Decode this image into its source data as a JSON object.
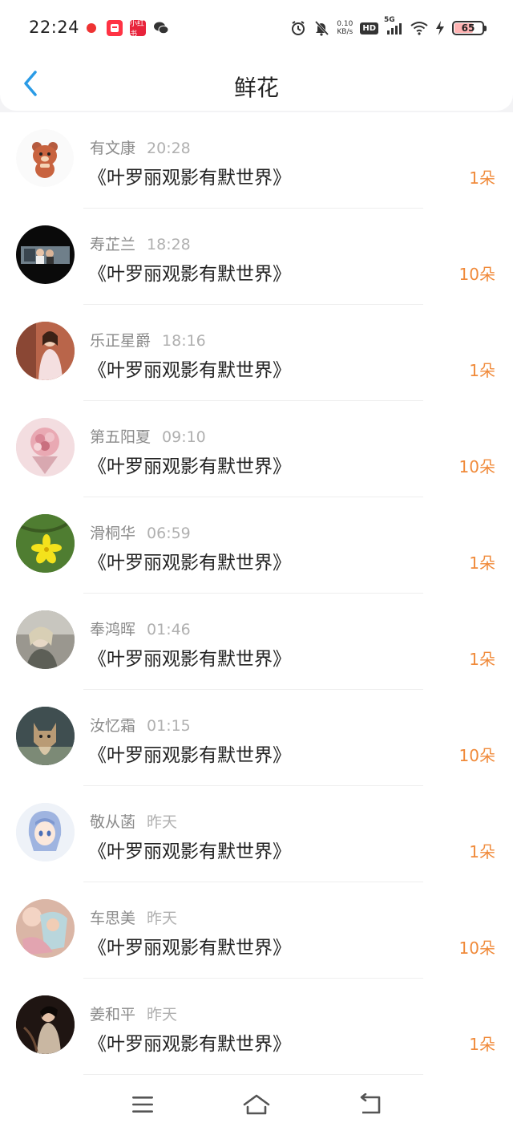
{
  "status_bar": {
    "time": "22:24",
    "net_speed_value": "0.10",
    "net_speed_unit": "KB/s",
    "hd_label": "HD",
    "signal_label": "5G",
    "battery_level": "65",
    "app_icon_labels": [
      "",
      "",
      "小红书",
      ""
    ]
  },
  "header": {
    "title": "鲜花"
  },
  "colors": {
    "amount": "#f08a3a",
    "back_arrow": "#2a9be6"
  },
  "rows": [
    {
      "name": "有文康",
      "time": "20:28",
      "title": "《叶罗丽观影有默世界》",
      "amount": "1朵"
    },
    {
      "name": "寿芷兰",
      "time": "18:28",
      "title": "《叶罗丽观影有默世界》",
      "amount": "10朵"
    },
    {
      "name": "乐正星爵",
      "time": "18:16",
      "title": "《叶罗丽观影有默世界》",
      "amount": "1朵"
    },
    {
      "name": "第五阳夏",
      "time": "09:10",
      "title": "《叶罗丽观影有默世界》",
      "amount": "10朵"
    },
    {
      "name": "滑桐华",
      "time": "06:59",
      "title": "《叶罗丽观影有默世界》",
      "amount": "1朵"
    },
    {
      "name": "奉鸿晖",
      "time": "01:46",
      "title": "《叶罗丽观影有默世界》",
      "amount": "1朵"
    },
    {
      "name": "汝忆霜",
      "time": "01:15",
      "title": "《叶罗丽观影有默世界》",
      "amount": "10朵"
    },
    {
      "name": "敬从菡",
      "time": "昨天",
      "title": "《叶罗丽观影有默世界》",
      "amount": "1朵"
    },
    {
      "name": "车思美",
      "time": "昨天",
      "title": "《叶罗丽观影有默世界》",
      "amount": "10朵"
    },
    {
      "name": "姜和平",
      "time": "昨天",
      "title": "《叶罗丽观影有默世界》",
      "amount": "1朵"
    }
  ],
  "bottom_nav": {
    "icons": [
      "menu-icon",
      "home-icon",
      "back-icon"
    ]
  }
}
